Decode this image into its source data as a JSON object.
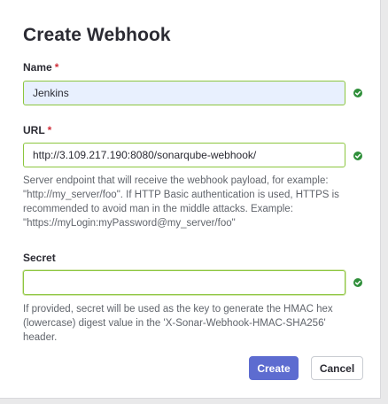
{
  "dialog": {
    "title": "Create Webhook"
  },
  "form": {
    "name": {
      "label": "Name",
      "required_marker": "*",
      "value": "Jenkins"
    },
    "url": {
      "label": "URL",
      "required_marker": "*",
      "value": "http://3.109.217.190:8080/sonarqube-webhook/",
      "help_lines": [
        "Server endpoint that will receive the webhook payload, for example:",
        "\"http://my_server/foo\". If HTTP Basic authentication is used, HTTPS is",
        "recommended to avoid man in the middle attacks. Example:",
        "\"https://myLogin:myPassword@my_server/foo\""
      ]
    },
    "secret": {
      "label": "Secret",
      "value": "",
      "help_lines": [
        "If provided, secret will be used as the key to generate the HMAC hex",
        "(lowercase) digest value in the 'X-Sonar-Webhook-HMAC-SHA256'",
        "header."
      ]
    }
  },
  "actions": {
    "create_label": "Create",
    "cancel_label": "Cancel"
  },
  "icons": {
    "valid": "check-circle-icon"
  },
  "colors": {
    "primary": "#5d6cd0",
    "valid_border": "#8cc63f",
    "valid_icon": "#2f8f3a",
    "required": "#d02f3a",
    "autofill_background": "#e8f0fe"
  }
}
